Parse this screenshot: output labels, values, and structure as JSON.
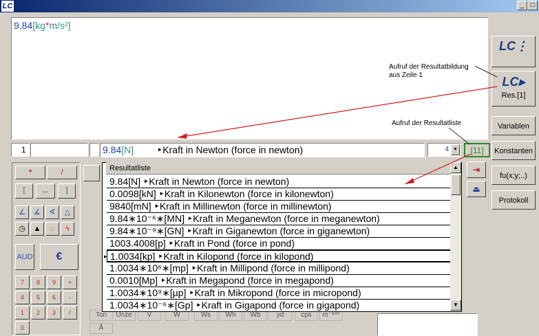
{
  "window": {
    "icon": "LC",
    "min_label": "_",
    "max_label": "□"
  },
  "editor": {
    "num": "9,84",
    "unit_open": "[",
    "unit_kg": "kg",
    "unit_star": "*",
    "unit_rest": "m/s²",
    "unit_close": "]"
  },
  "annotations": {
    "resultatbildung_1": "Aufruf der Resultatbildung",
    "resultatbildung_2": "aus Zeile 1",
    "resultatliste": "Aufruf der Resultatliste"
  },
  "side_buttons": {
    "res": "Res.[1]",
    "variablen": "Variablen",
    "konstanten": "Konstanten",
    "fu": "fu(x;y;..)",
    "protokoll": "Protokoll"
  },
  "line_field": "1",
  "result_bar": {
    "value": "9.84",
    "unit": "[N]",
    "desc": "‣Kraft in Newton (force in newton)",
    "spin": "4",
    "count": "[11]"
  },
  "keypad": {
    "mul": "*",
    "div": "/",
    "open": "[",
    "mid": "...",
    "close": "]",
    "aud": "AUD",
    "digits": [
      "7",
      "8",
      "9",
      "+",
      "4",
      "5",
      "6",
      "-",
      "1",
      "2",
      "3",
      "/",
      "0"
    ]
  },
  "background_cells": [
    "Ton",
    "Unze",
    "V",
    "W",
    "Ws",
    "Wh",
    "Wb",
    "yd",
    "cps",
    "m⁻¹⁰⁰",
    "Å"
  ],
  "result_list": {
    "header": "Resultatliste",
    "rows": [
      "9.84[N]  ‣Kraft in Newton (force in newton)",
      "0.0098[kN]  ‣Kraft in Kilonewton (force in kilonewton)",
      "9840[mN]  ‣Kraft in Millinewton (force in millinewton)",
      "9.84∗10⁻⁶∗[MN]  ‣Kraft in Meganewton (force in meganewton)",
      "9.84∗10⁻⁹∗[GN]  ‣Kraft in Giganewton (force in giganewton)",
      "1003.4008[p]  ‣Kraft in Pond (force in pond)",
      "1.0034[kp]          ‣Kraft in Kilopond (force in kilopond)",
      "1.0034∗10⁶∗[mp]  ‣Kraft in Millipond (force in millipond)",
      "0.0010[Mp]  ‣Kraft in Megapond (force in megapond)",
      "1.0034∗10⁹∗[µp]  ‣Kraft in Mikropond (force in micropond)",
      "1.0034∗10⁻⁶∗[Gp]  ‣Kraft in Gigapond (force in gigapond)"
    ],
    "selected_index": 6
  },
  "colors": {
    "accent_blue": "#1f3fa0",
    "unit_teal": "#3a8f8a",
    "star_red": "#cc2222",
    "arrow_red": "#cc2020"
  }
}
